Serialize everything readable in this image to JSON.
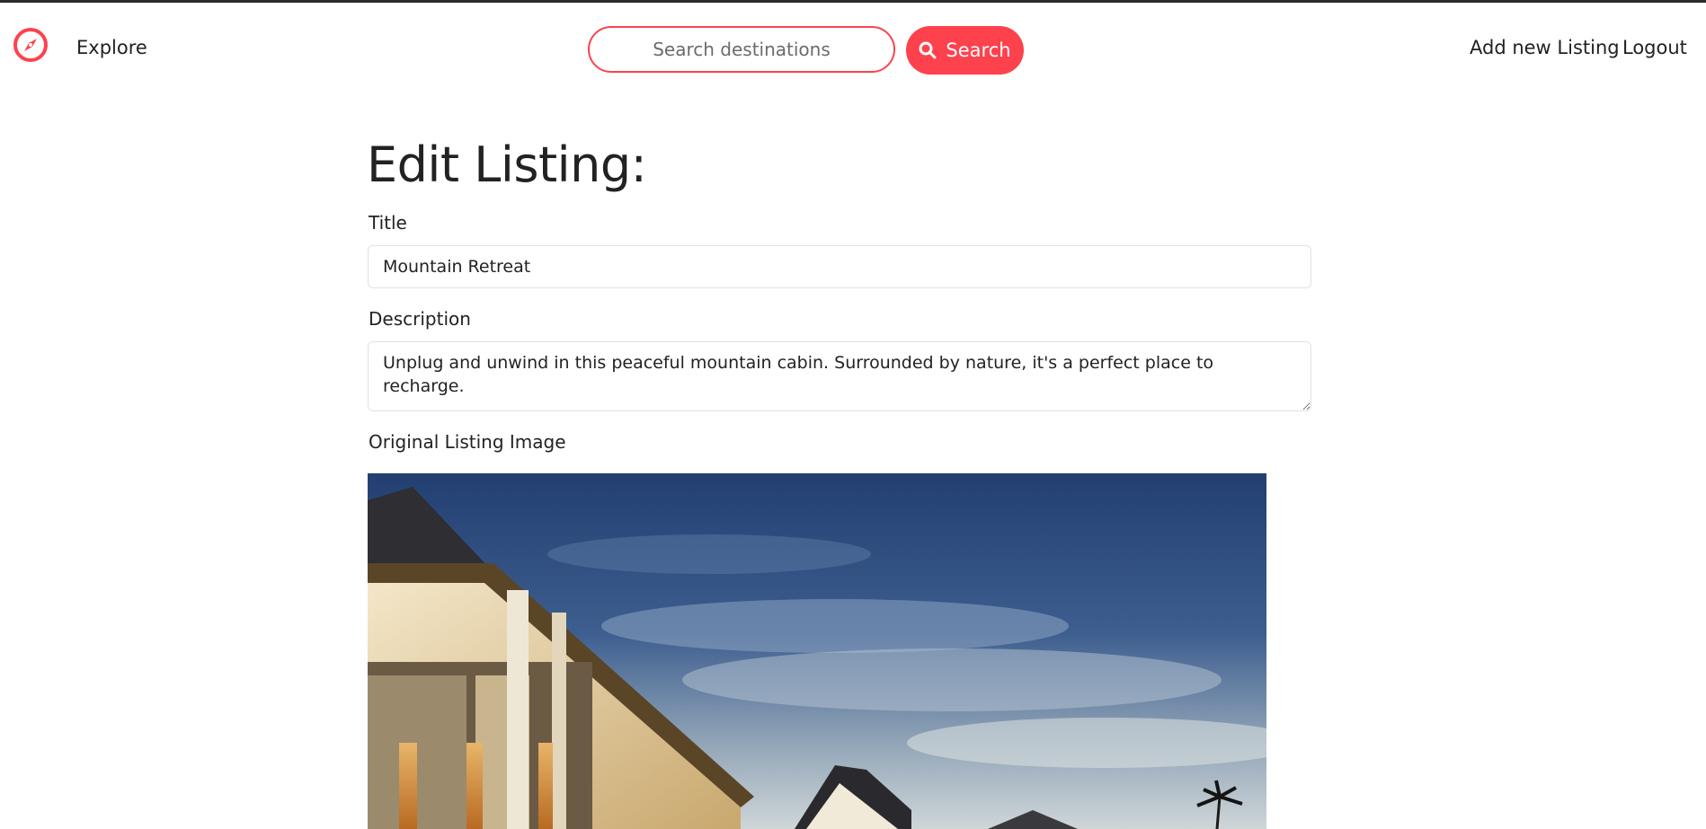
{
  "nav": {
    "explore_label": "Explore",
    "search_placeholder": "Search destinations",
    "search_button_label": "Search",
    "add_listing_label": "Add new Listing",
    "logout_label": "Logout"
  },
  "form": {
    "heading": "Edit Listing:",
    "title_label": "Title",
    "title_value": "Mountain Retreat",
    "description_label": "Description",
    "description_value": "Unplug and unwind in this peaceful mountain cabin. Surrounded by nature, it's a perfect place to recharge.",
    "image_label": "Original Listing Image"
  },
  "icons": {
    "logo": "compass-icon",
    "search": "search-icon"
  },
  "colors": {
    "accent": "#fe424d",
    "text": "#222222",
    "input_border": "#dee2e6"
  }
}
